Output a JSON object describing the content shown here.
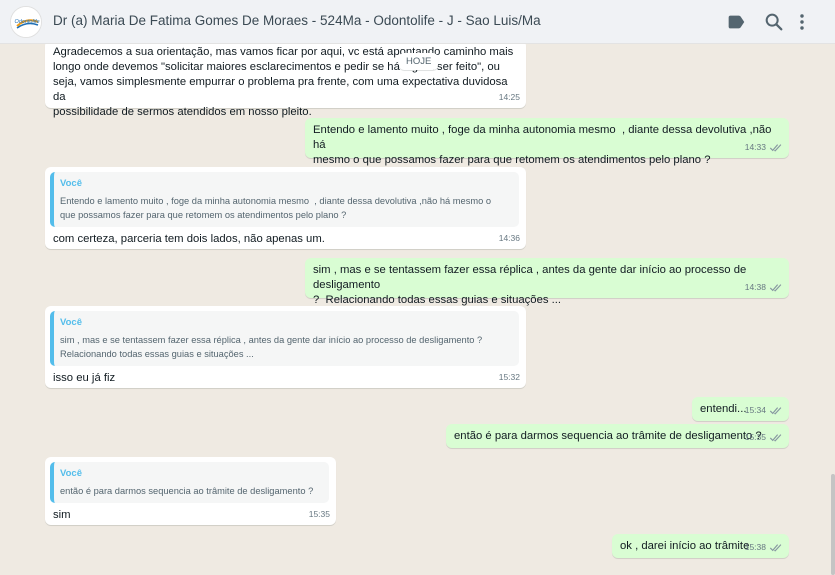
{
  "header": {
    "title": "Dr (a) Maria De Fatima Gomes De Moraes - 524Ma - Odontolife - J - Sao Luis/Ma",
    "avatar_text": "Odontolife",
    "icons": [
      "label-icon",
      "search-icon",
      "menu-dots-icon"
    ]
  },
  "date_chip": "HOJE",
  "messages": [
    {
      "direction": "in",
      "text": "Agradecemos a sua orientação, mas vamos ficar por aqui, vc está apontando caminho mais\nlongo onde devemos \"solicitar maiores esclarecimentos e pedir se há algo a ser feito\", ou\nseja, vamos simplesmente empurrar o problema pra frente, com uma expectativa duvidosa da\npossibilidade de sermos atendidos em nosso pleito.",
      "time": "14:25"
    },
    {
      "direction": "out",
      "text": "Entendo e lamento muito , foge da minha autonomia mesmo  , diante dessa devolutiva ,não há\nmesmo o que possamos fazer para que retomem os atendimentos pelo plano ?",
      "time": "14:33"
    },
    {
      "direction": "in",
      "quote_author": "Você",
      "quote_text": "Entendo e lamento muito , foge da minha autonomia mesmo  , diante dessa devolutiva ,não há mesmo o\nque possamos fazer para que retomem os atendimentos pelo plano ?",
      "text": "com certeza, parceria tem dois lados, não apenas um.",
      "time": "14:36"
    },
    {
      "direction": "out",
      "text": "sim , mas e se tentassem fazer essa réplica , antes da gente dar início ao processo de desligamento\n?  Relacionando todas essas guias e situações ...",
      "time": "14:38"
    },
    {
      "direction": "in",
      "quote_author": "Você",
      "quote_text": "sim , mas e se tentassem fazer essa réplica , antes da gente dar início ao processo de desligamento ?\nRelacionando todas essas guias e situações ...",
      "text": "isso eu já fiz",
      "time": "15:32"
    },
    {
      "direction": "out",
      "text": "entendi...",
      "time": "15:34"
    },
    {
      "direction": "out",
      "text": "então é para darmos sequencia ao trâmite de desligamento ?",
      "time": "15:35"
    },
    {
      "direction": "in",
      "quote_author": "Você",
      "quote_text": "então é para darmos sequencia ao trâmite de desligamento ?",
      "text": "sim",
      "time": "15:35"
    },
    {
      "direction": "out",
      "text": "ok , darei início ao trâmite",
      "time": "15:38"
    }
  ],
  "colors": {
    "header_bg": "#f0f2f5",
    "chat_bg": "#efeae2",
    "incoming_bubble": "#ffffff",
    "outgoing_bubble": "#d9fdd3",
    "quote_accent": "#53bdeb",
    "ticks": "#8696a0"
  }
}
